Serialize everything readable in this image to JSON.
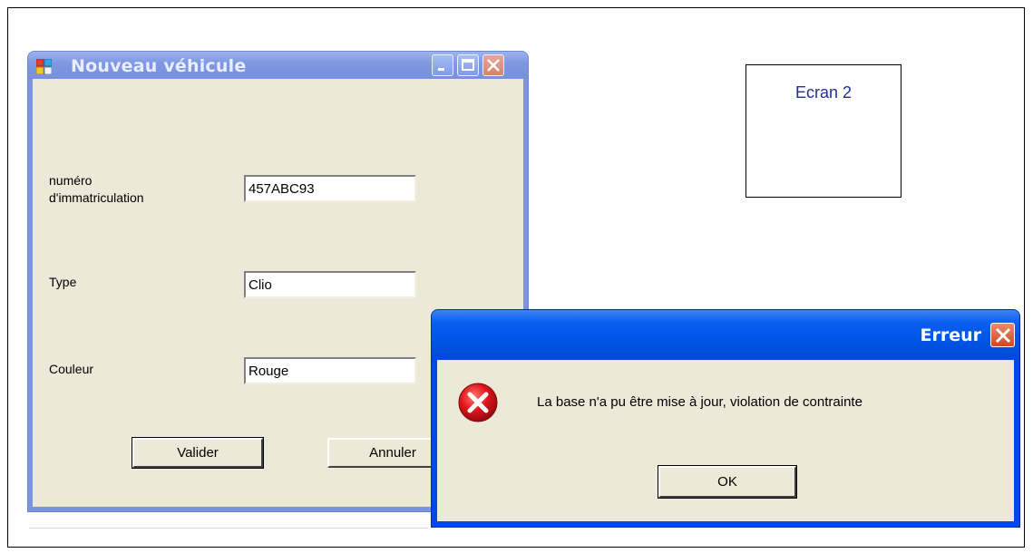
{
  "screen_label": "Ecran 2",
  "main_window": {
    "title": "Nouveau véhicule",
    "fields": {
      "registration": {
        "label": "numéro d'immatriculation",
        "value": "457ABC93"
      },
      "type": {
        "label": "Type",
        "value": "Clio"
      },
      "color": {
        "label": "Couleur",
        "value": "Rouge"
      }
    },
    "validate_label": "Valider",
    "cancel_label": "Annuler"
  },
  "error_dialog": {
    "title": "Erreur",
    "message": "La base n'a pu être mise à jour, violation de contrainte",
    "ok_label": "OK"
  },
  "colors": {
    "xp_title_active": "#0055e6",
    "xp_title_inactive": "#7f98e2",
    "dialog_face": "#ece9d8",
    "error_red": "#d4131b"
  },
  "icons": [
    "app-icon",
    "minimize-icon",
    "maximize-icon",
    "close-icon",
    "error-icon"
  ]
}
